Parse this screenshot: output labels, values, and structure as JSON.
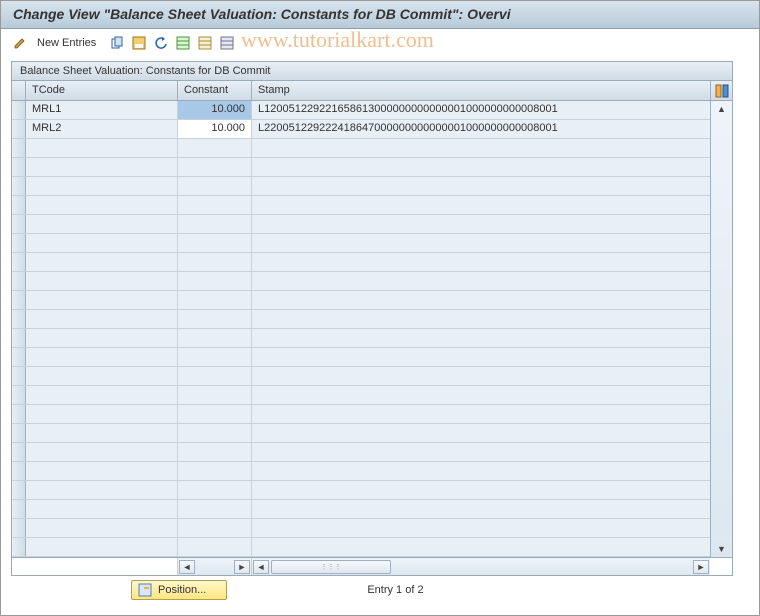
{
  "window": {
    "title": "Change View \"Balance Sheet Valuation: Constants for DB Commit\": Overvi"
  },
  "toolbar": {
    "new_entries_label": "New Entries",
    "icons": {
      "pencil": "change-icon",
      "copy": "copy-icon",
      "save": "save-icon",
      "undo": "undo-icon",
      "grid1": "select-all-icon",
      "grid2": "deselect-icon",
      "grid3": "delimit-icon"
    }
  },
  "panel": {
    "title": "Balance Sheet Valuation: Constants for DB Commit"
  },
  "table": {
    "columns": {
      "tcode": "TCode",
      "constant": "Constant",
      "stamp": "Stamp"
    },
    "rows": [
      {
        "tcode": "MRL1",
        "constant": "10.000",
        "stamp": "L120051229221658613000000000000001000000000008001"
      },
      {
        "tcode": "MRL2",
        "constant": "10.000",
        "stamp": "L220051229222418647000000000000001000000000008001"
      }
    ],
    "empty_row_count": 22
  },
  "footer": {
    "position_label": "Position...",
    "entry_text": "Entry 1 of 2"
  },
  "watermark": "www.tutorialkart.com"
}
